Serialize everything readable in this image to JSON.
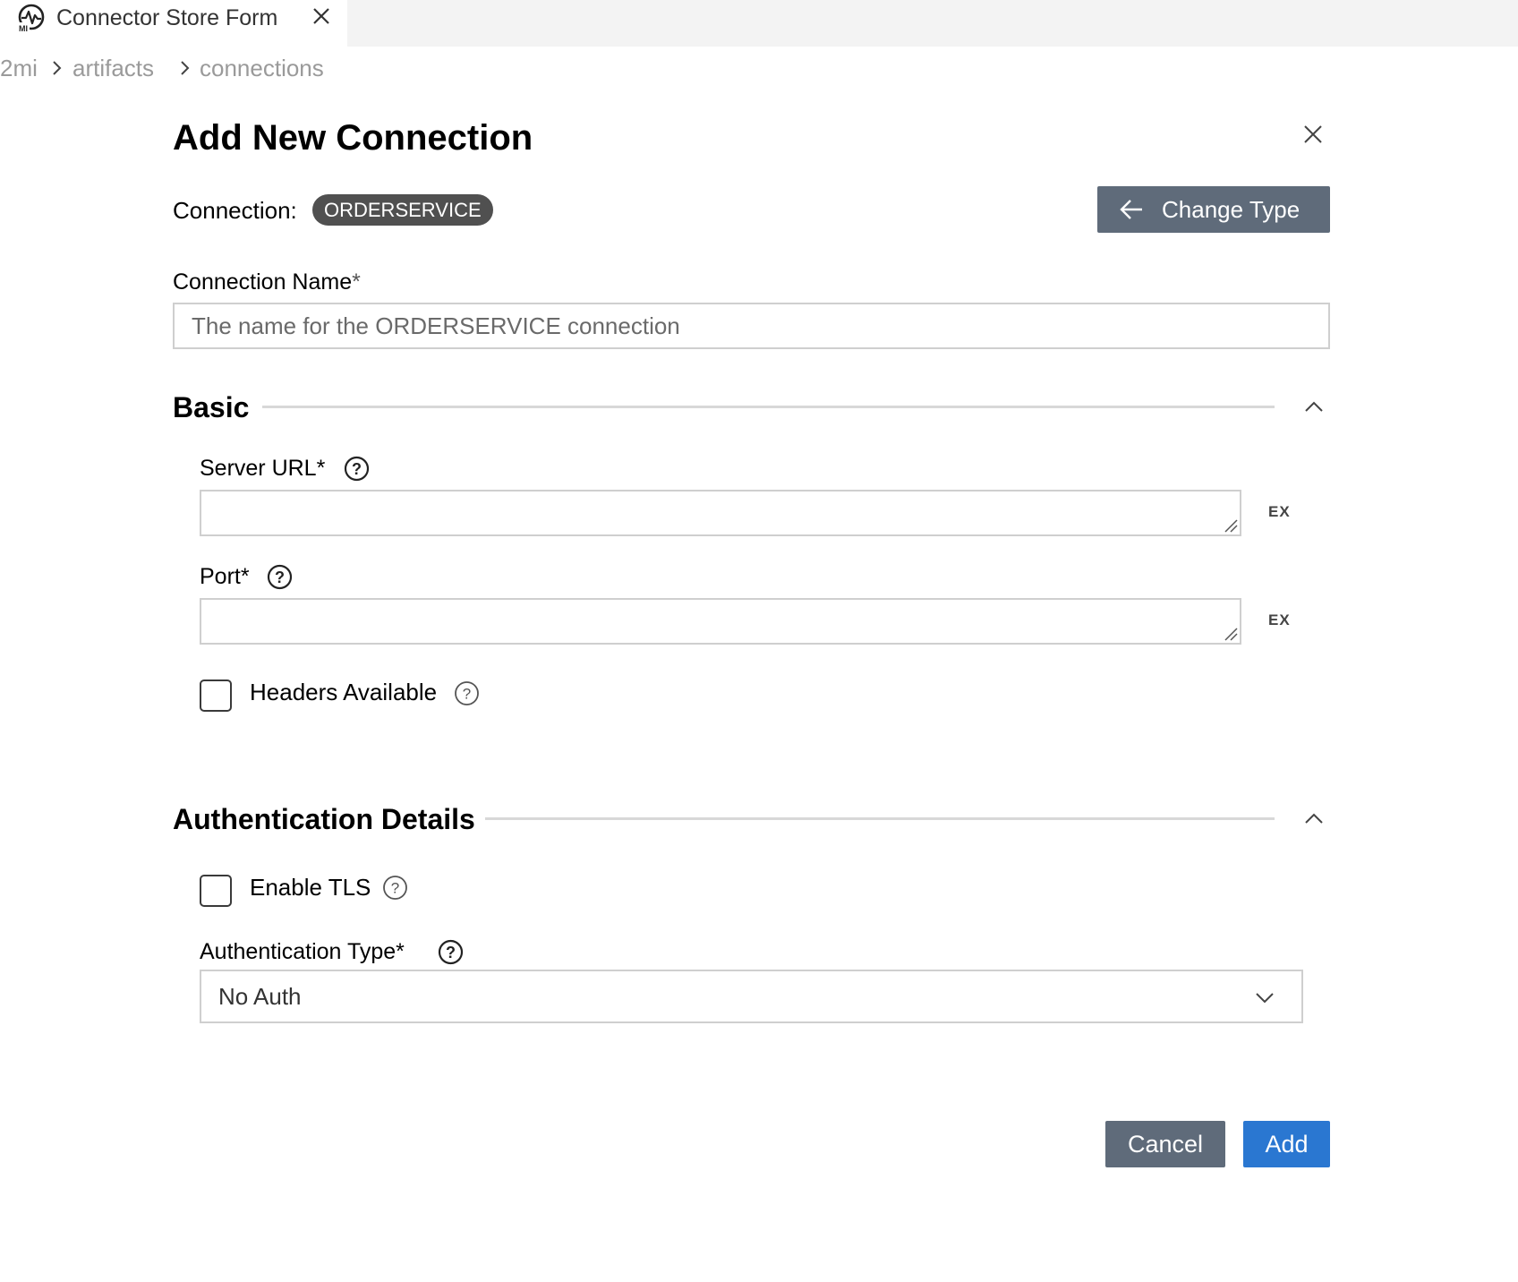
{
  "tab": {
    "title": "Connector Store Form",
    "icon": "mi-logo-icon"
  },
  "breadcrumb": [
    "2mi",
    "artifacts",
    "connections"
  ],
  "form": {
    "title": "Add New Connection",
    "connection_label": "Connection:",
    "connection_type": "ORDERSERVICE",
    "change_type_label": "Change Type",
    "connection_name_label": "Connection Name",
    "connection_name_placeholder": "The name for the ORDERSERVICE connection",
    "required_mark": "*"
  },
  "basic": {
    "title": "Basic",
    "server_url_label": "Server URL*",
    "server_url_value": "",
    "port_label": "Port*",
    "port_value": "",
    "expression_toggle": "EX",
    "headers_available_label": "Headers Available",
    "headers_available_checked": false
  },
  "auth": {
    "title": "Authentication Details",
    "enable_tls_label": "Enable TLS",
    "enable_tls_checked": false,
    "auth_type_label": "Authentication Type*",
    "auth_type_value": "No Auth"
  },
  "actions": {
    "cancel_label": "Cancel",
    "add_label": "Add"
  },
  "colors": {
    "secondary_button": "#5f6b7a",
    "primary_button": "#2a77d1",
    "badge": "#505050"
  }
}
